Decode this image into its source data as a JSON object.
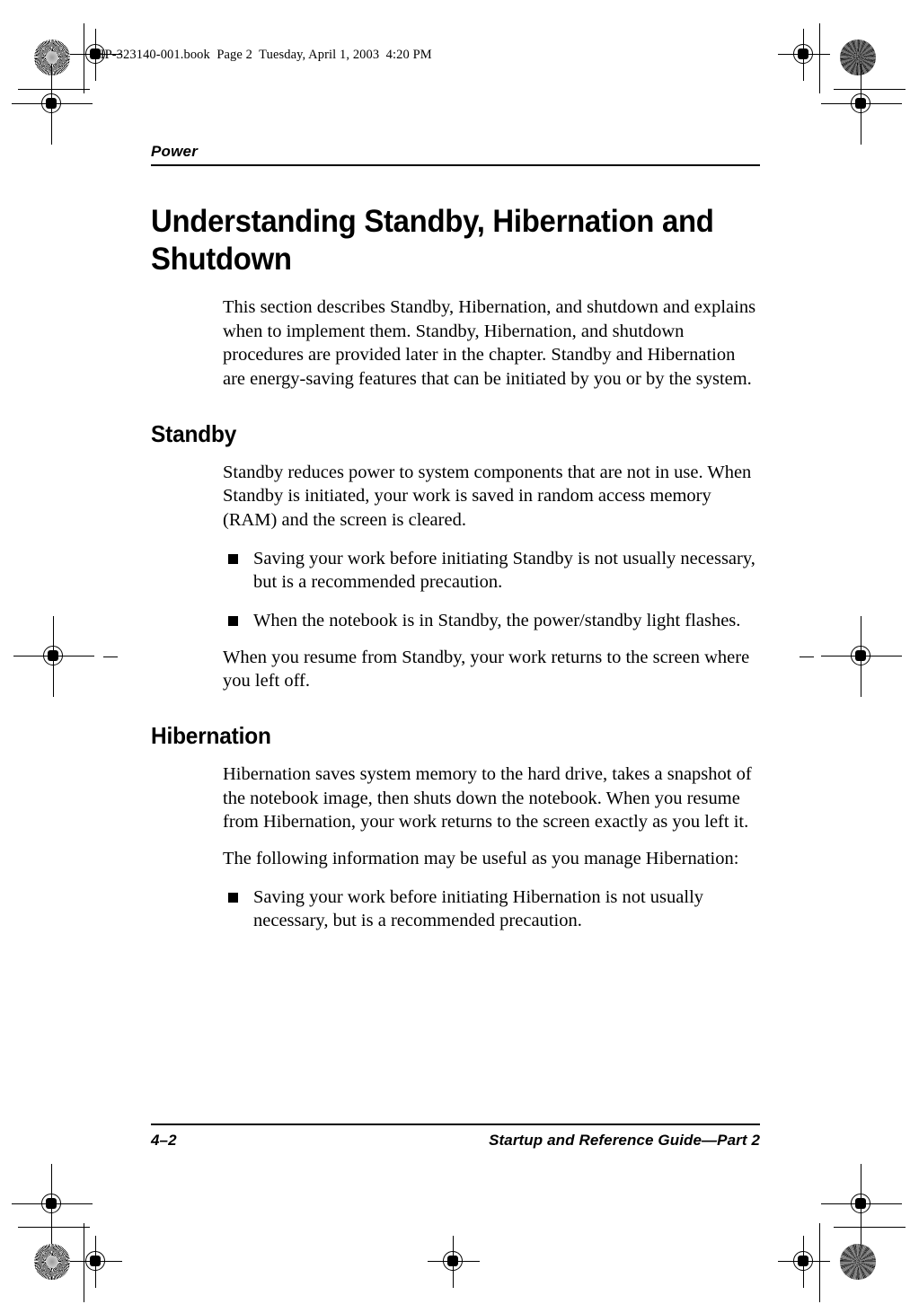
{
  "file_stamp": "HP-323140-001.book  Page 2  Tuesday, April 1, 2003  4:20 PM",
  "running_head": "Power",
  "title": "Understanding Standby, Hibernation and Shutdown",
  "intro_paragraph": "This section describes Standby, Hibernation, and shutdown and explains when to implement them. Standby, Hibernation, and shutdown procedures are provided later in the chapter. Standby and Hibernation are energy-saving features that can be initiated by you or by the system.",
  "sections": [
    {
      "heading": "Standby",
      "paragraph_1": "Standby reduces power to system components that are not in use. When Standby is initiated, your work is saved in random access memory (RAM) and the screen is cleared.",
      "bullets": [
        "Saving your work before initiating Standby is not usually necessary, but is a recommended precaution.",
        "When the notebook is in Standby, the power/standby light flashes."
      ],
      "paragraph_2": "When you resume from Standby, your work returns to the screen where you left off."
    },
    {
      "heading": "Hibernation",
      "paragraph_1": "Hibernation saves system memory to the hard drive, takes a snapshot of the notebook image, then shuts down the notebook. When you resume from Hibernation, your work returns to the screen exactly as you left it.",
      "paragraph_2": "The following information may be useful as you manage Hibernation:",
      "bullets": [
        "Saving your work before initiating Hibernation is not usually necessary, but is a recommended precaution."
      ]
    }
  ],
  "footer": {
    "page_number": "4–2",
    "guide_title": "Startup and Reference Guide—Part 2"
  },
  "colors": {
    "text": "#000000",
    "page_background": "#ffffff",
    "rule": "#000000"
  }
}
